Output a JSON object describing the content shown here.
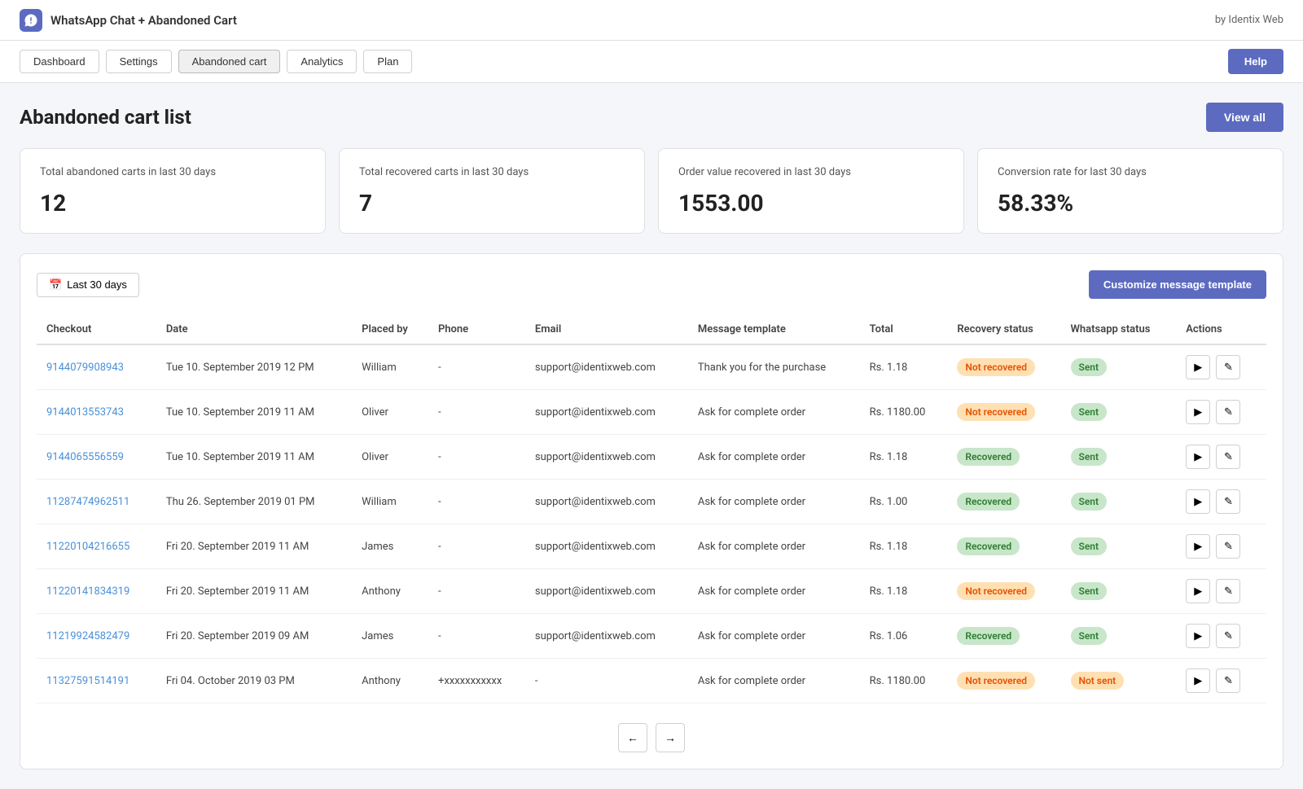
{
  "app": {
    "title": "WhatsApp Chat + Abandoned Cart",
    "by": "by Identix Web",
    "logo_icon": "chat-icon"
  },
  "nav": {
    "items": [
      {
        "id": "dashboard",
        "label": "Dashboard"
      },
      {
        "id": "settings",
        "label": "Settings"
      },
      {
        "id": "abandoned-cart",
        "label": "Abandoned cart",
        "active": true
      },
      {
        "id": "analytics",
        "label": "Analytics"
      },
      {
        "id": "plan",
        "label": "Plan"
      }
    ],
    "help_label": "Help"
  },
  "page": {
    "title": "Abandoned cart list",
    "view_all_label": "View all"
  },
  "stats": [
    {
      "id": "total-abandoned",
      "label": "Total abandoned carts in last 30 days",
      "value": "12"
    },
    {
      "id": "total-recovered",
      "label": "Total recovered carts in last 30 days",
      "value": "7"
    },
    {
      "id": "order-value",
      "label": "Order value recovered in last 30 days",
      "value": "1553.00"
    },
    {
      "id": "conversion-rate",
      "label": "Conversion rate for last 30 days",
      "value": "58.33%"
    }
  ],
  "toolbar": {
    "date_filter_label": "Last 30 days",
    "customize_label": "Customize message template",
    "calendar_icon": "calendar-icon"
  },
  "table": {
    "columns": [
      "Checkout",
      "Date",
      "Placed by",
      "Phone",
      "Email",
      "Message template",
      "Total",
      "Recovery status",
      "Whatsapp status",
      "Actions"
    ],
    "rows": [
      {
        "checkout": "9144079908943",
        "date": "Tue 10. September 2019 12 PM",
        "placed_by": "William",
        "phone": "-",
        "email": "support@identixweb.com",
        "message_template": "Thank you for the purchase",
        "total": "Rs. 1.18",
        "recovery_status": "Not recovered",
        "recovery_status_type": "not-recovered",
        "whatsapp_status": "Sent",
        "whatsapp_status_type": "sent"
      },
      {
        "checkout": "9144013553743",
        "date": "Tue 10. September 2019 11 AM",
        "placed_by": "Oliver",
        "phone": "-",
        "email": "support@identixweb.com",
        "message_template": "Ask for complete order",
        "total": "Rs. 1180.00",
        "recovery_status": "Not recovered",
        "recovery_status_type": "not-recovered",
        "whatsapp_status": "Sent",
        "whatsapp_status_type": "sent"
      },
      {
        "checkout": "9144065556559",
        "date": "Tue 10. September 2019 11 AM",
        "placed_by": "Oliver",
        "phone": "-",
        "email": "support@identixweb.com",
        "message_template": "Ask for complete order",
        "total": "Rs. 1.18",
        "recovery_status": "Recovered",
        "recovery_status_type": "recovered",
        "whatsapp_status": "Sent",
        "whatsapp_status_type": "sent"
      },
      {
        "checkout": "11287474962511",
        "date": "Thu 26. September 2019 01 PM",
        "placed_by": "William",
        "phone": "-",
        "email": "support@identixweb.com",
        "message_template": "Ask for complete order",
        "total": "Rs. 1.00",
        "recovery_status": "Recovered",
        "recovery_status_type": "recovered",
        "whatsapp_status": "Sent",
        "whatsapp_status_type": "sent"
      },
      {
        "checkout": "11220104216655",
        "date": "Fri 20. September 2019 11 AM",
        "placed_by": "James",
        "phone": "-",
        "email": "support@identixweb.com",
        "message_template": "Ask for complete order",
        "total": "Rs. 1.18",
        "recovery_status": "Recovered",
        "recovery_status_type": "recovered",
        "whatsapp_status": "Sent",
        "whatsapp_status_type": "sent"
      },
      {
        "checkout": "11220141834319",
        "date": "Fri 20. September 2019 11 AM",
        "placed_by": "Anthony",
        "phone": "-",
        "email": "support@identixweb.com",
        "message_template": "Ask for complete order",
        "total": "Rs. 1.18",
        "recovery_status": "Not recovered",
        "recovery_status_type": "not-recovered",
        "whatsapp_status": "Sent",
        "whatsapp_status_type": "sent"
      },
      {
        "checkout": "11219924582479",
        "date": "Fri 20. September 2019 09 AM",
        "placed_by": "James",
        "phone": "-",
        "email": "support@identixweb.com",
        "message_template": "Ask for complete order",
        "total": "Rs. 1.06",
        "recovery_status": "Recovered",
        "recovery_status_type": "recovered",
        "whatsapp_status": "Sent",
        "whatsapp_status_type": "sent"
      },
      {
        "checkout": "11327591514191",
        "date": "Fri 04. October 2019 03 PM",
        "placed_by": "Anthony",
        "phone": "+xxxxxxxxxxx",
        "email": "-",
        "message_template": "Ask for complete order",
        "total": "Rs. 1180.00",
        "recovery_status": "Not recovered",
        "recovery_status_type": "not-recovered",
        "whatsapp_status": "Not sent",
        "whatsapp_status_type": "not-sent"
      }
    ]
  },
  "pagination": {
    "prev_icon": "chevron-left-icon",
    "next_icon": "chevron-right-icon"
  }
}
